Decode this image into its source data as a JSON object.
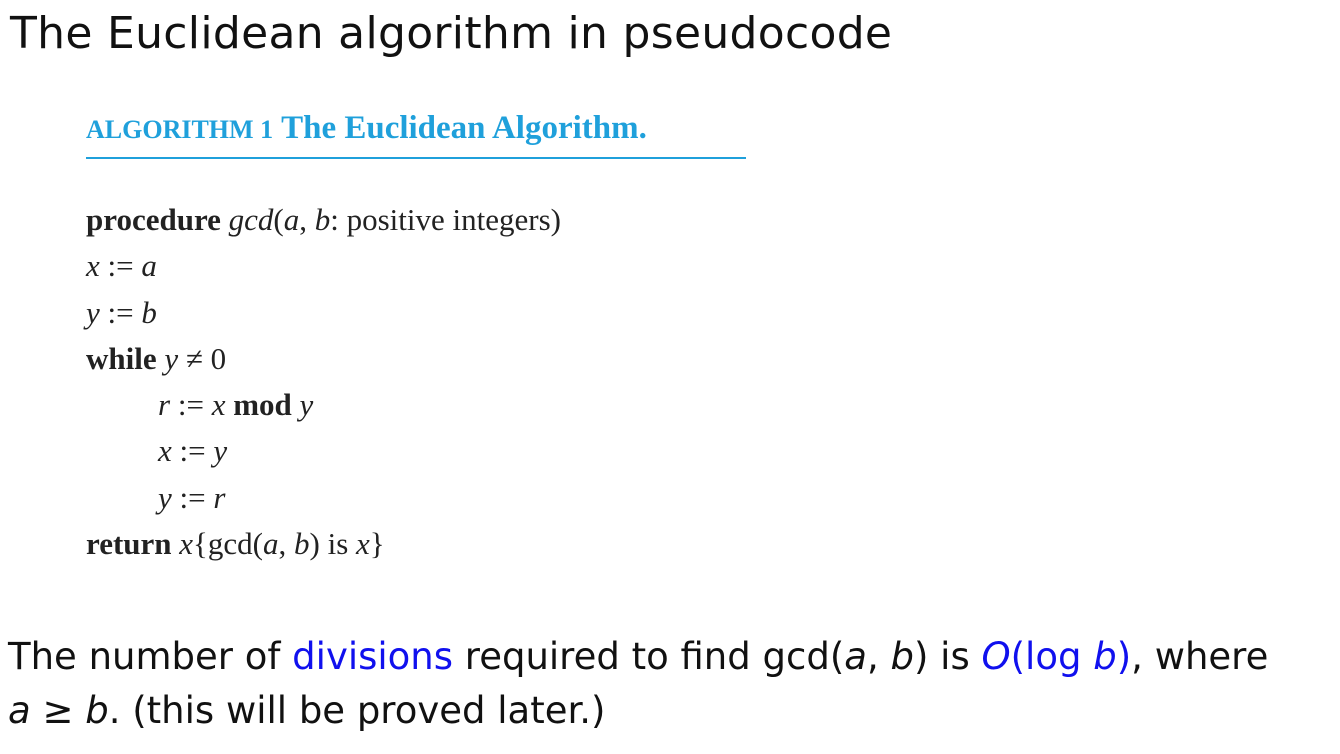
{
  "slide": {
    "title": "The Euclidean algorithm in pseudocode"
  },
  "algorithm": {
    "label": "ALGORITHM 1",
    "name": "The Euclidean Algorithm.",
    "accent_color": "#1fa0db",
    "lines": {
      "l1": {
        "kw": "procedure",
        "fn": "gcd",
        "open": "(",
        "a": "a",
        "comma": ", ",
        "b": "b",
        "rest": ": positive integers)"
      },
      "l2": {
        "x": "x",
        "assign": " := ",
        "a": "a"
      },
      "l3": {
        "y": "y",
        "assign": " := ",
        "b": "b"
      },
      "l4": {
        "kw": "while",
        "y": "y",
        "op": " ≠ ",
        "zero": "0"
      },
      "l5": {
        "r": "r",
        "assign": " := ",
        "x": "x",
        "kw": "mod",
        "y": "y"
      },
      "l6": {
        "x": "x",
        "assign": " := ",
        "y": "y"
      },
      "l7": {
        "y": "y",
        "assign": " := ",
        "r": "r"
      },
      "l8": {
        "kw": "return",
        "x": "x",
        "open": "{gcd(",
        "a": "a",
        "comma": ", ",
        "b": "b",
        "mid": ") is ",
        "x2": "x",
        "close": "}"
      }
    }
  },
  "note": {
    "p1": "The number of ",
    "link_divisions": "divisions",
    "p2": " required to find gcd(",
    "a": "a",
    "comma": ", ",
    "b": "b",
    "p3": ") is ",
    "big_o_open": "O(log ",
    "big_o_b": "b",
    "big_o_close": ")",
    "p4": ", where",
    "line2_a": "a",
    "line2_op": " ≥ ",
    "line2_b": "b",
    "line2_rest": ". (this will be proved later.)",
    "accent_color": "#1010ee"
  }
}
